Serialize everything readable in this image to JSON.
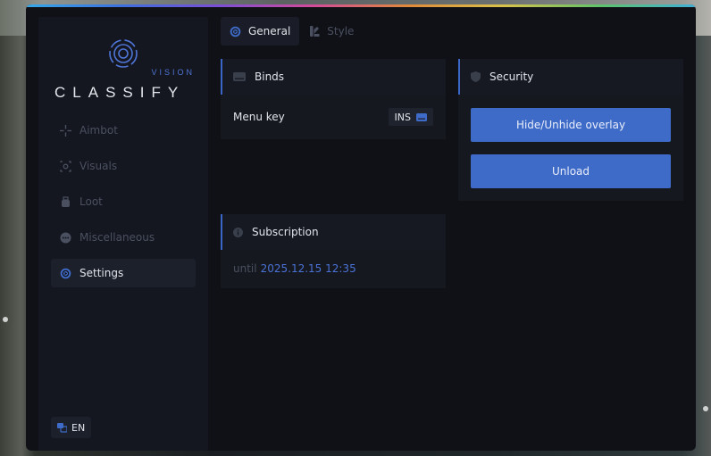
{
  "logo": {
    "title": "CLASSIFY",
    "subtitle": "VISION"
  },
  "sidebar": {
    "items": [
      {
        "label": "Aimbot",
        "icon": "crosshair-icon"
      },
      {
        "label": "Visuals",
        "icon": "eye-icon"
      },
      {
        "label": "Loot",
        "icon": "bag-icon"
      },
      {
        "label": "Miscellaneous",
        "icon": "ellipsis-icon"
      },
      {
        "label": "Settings",
        "icon": "gear-icon",
        "active": true
      }
    ],
    "language": "EN"
  },
  "tabs": [
    {
      "label": "General",
      "active": true
    },
    {
      "label": "Style",
      "active": false
    }
  ],
  "binds": {
    "title": "Binds",
    "menu_key_label": "Menu key",
    "menu_key_value": "INS"
  },
  "security": {
    "title": "Security",
    "hide_button": "Hide/Unhide overlay",
    "unload_button": "Unload"
  },
  "subscription": {
    "title": "Subscription",
    "prefix": "until",
    "date": "2025.12.15 12:35"
  },
  "colors": {
    "accent": "#3f6bc8",
    "window_bg": "#0f1117",
    "panel_bg": "#15181f",
    "muted_text": "#4b5060"
  }
}
